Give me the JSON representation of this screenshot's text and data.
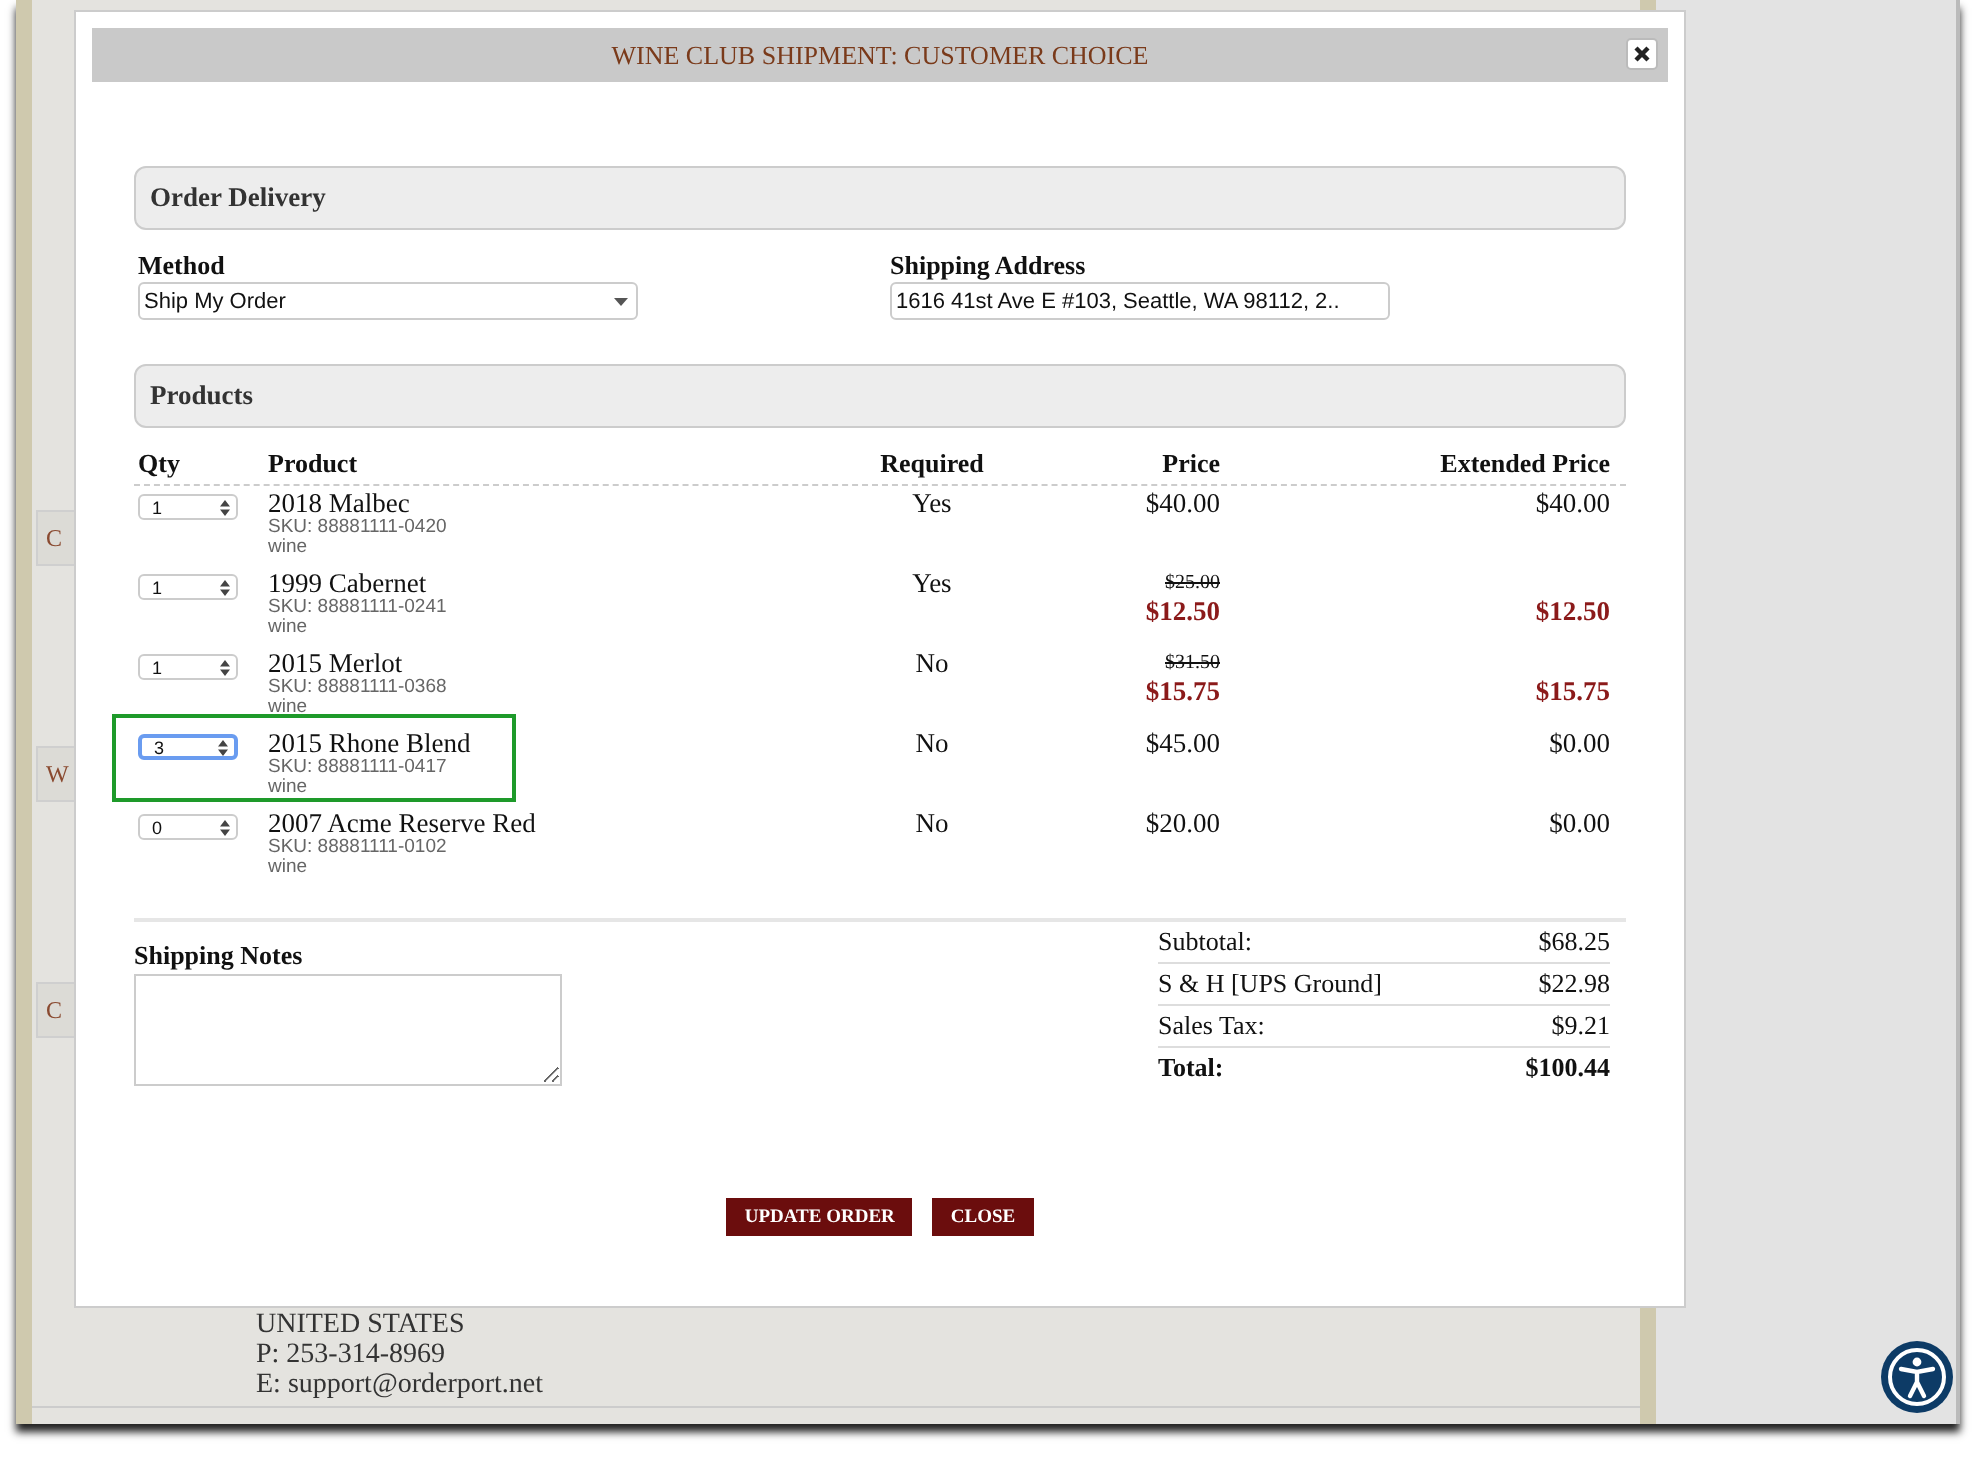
{
  "background": {
    "side_tabs": [
      "C",
      "W",
      "C"
    ],
    "address_lines": [
      "UNITED STATES",
      "P: 253-314-8969",
      "E: support@orderport.net"
    ]
  },
  "modal": {
    "title": "WINE CLUB SHIPMENT: CUSTOMER CHOICE"
  },
  "order_delivery": {
    "heading": "Order Delivery",
    "method": {
      "label": "Method",
      "value": "Ship My Order"
    },
    "shipping_address": {
      "label": "Shipping Address",
      "value": "1616 41st Ave E #103, Seattle, WA 98112, 2.."
    }
  },
  "products": {
    "heading": "Products",
    "columns": [
      "Qty",
      "Product",
      "Required",
      "Price",
      "Extended Price"
    ],
    "rows": [
      {
        "qty": "1",
        "name": "2018 Malbec",
        "sku": "SKU: 88881111-0420",
        "type": "wine",
        "required": "Yes",
        "sale": false,
        "price": "$40.00",
        "extended": "$40.00",
        "selected": false
      },
      {
        "qty": "1",
        "name": "1999 Cabernet",
        "sku": "SKU: 88881111-0241",
        "type": "wine",
        "required": "Yes",
        "sale": true,
        "original_price": "$25.00",
        "price": "$12.50",
        "extended": "$12.50",
        "selected": false
      },
      {
        "qty": "1",
        "name": "2015 Merlot",
        "sku": "SKU: 88881111-0368",
        "type": "wine",
        "required": "No",
        "sale": true,
        "original_price": "$31.50",
        "price": "$15.75",
        "extended": "$15.75",
        "selected": false
      },
      {
        "qty": "3",
        "name": "2015 Rhone Blend",
        "sku": "SKU: 88881111-0417",
        "type": "wine",
        "required": "No",
        "sale": false,
        "price": "$45.00",
        "extended": "$0.00",
        "selected": true
      },
      {
        "qty": "0",
        "name": "2007 Acme Reserve Red",
        "sku": "SKU: 88881111-0102",
        "type": "wine",
        "required": "No",
        "sale": false,
        "price": "$20.00",
        "extended": "$0.00",
        "selected": false
      }
    ]
  },
  "shipping_notes": {
    "label": "Shipping Notes"
  },
  "totals": [
    {
      "label": "Subtotal:",
      "value": "$68.25",
      "kind": "line"
    },
    {
      "label": "S & H [UPS Ground]",
      "value": "$22.98",
      "kind": "line"
    },
    {
      "label": "Sales Tax:",
      "value": "$9.21",
      "kind": "line"
    },
    {
      "label": "Total:",
      "value": "$100.44",
      "kind": "total"
    }
  ],
  "buttons": [
    "UPDATE ORDER",
    "CLOSE"
  ]
}
